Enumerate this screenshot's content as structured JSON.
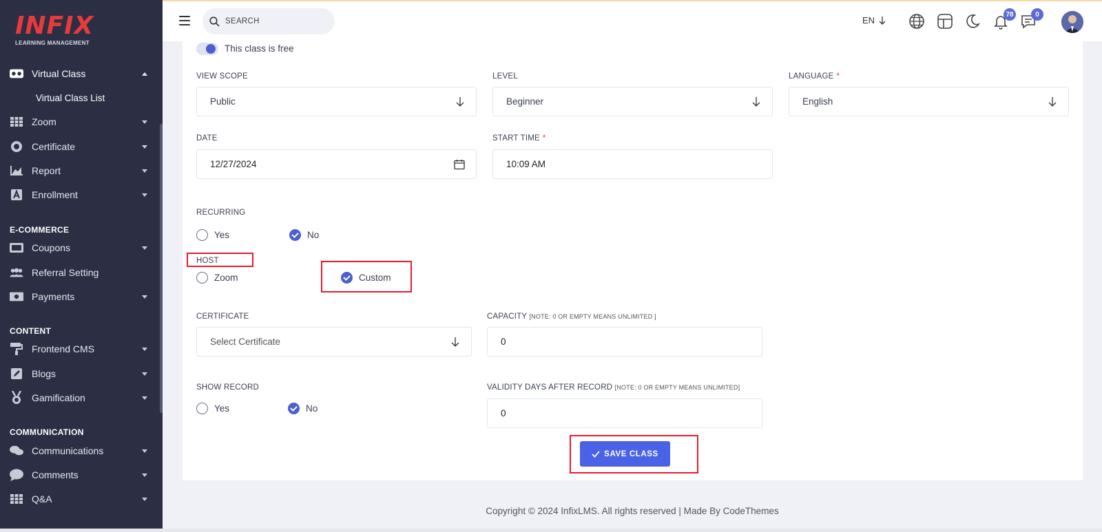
{
  "brand": {
    "logo": "INFIX",
    "tagline": "LEARNING MANAGEMENT",
    "logo_color": "#e83a3a"
  },
  "sidebar": {
    "active_item": "Virtual Class",
    "active_sub": "Virtual Class List",
    "items": [
      {
        "label": "Zoom",
        "icon": "grid-icon"
      },
      {
        "label": "Certificate",
        "icon": "certificate-icon"
      },
      {
        "label": "Report",
        "icon": "chart-icon"
      },
      {
        "label": "Enrollment",
        "icon": "enrollment-icon"
      }
    ],
    "sections": {
      "ecommerce": "E-COMMERCE",
      "content": "CONTENT",
      "communication": "COMMUNICATION"
    },
    "ecommerce_items": [
      {
        "label": "Coupons",
        "icon": "coupon-icon"
      },
      {
        "label": "Referral Setting",
        "icon": "users-icon"
      },
      {
        "label": "Payments",
        "icon": "money-icon"
      }
    ],
    "content_items": [
      {
        "label": "Frontend CMS",
        "icon": "paint-roller-icon"
      },
      {
        "label": "Blogs",
        "icon": "pencil-icon"
      },
      {
        "label": "Gamification",
        "icon": "medal-icon"
      }
    ],
    "communication_items": [
      {
        "label": "Communications",
        "icon": "chat-icon"
      },
      {
        "label": "Comments",
        "icon": "comment-icon"
      },
      {
        "label": "Q&A",
        "icon": "grid-icon"
      }
    ]
  },
  "header": {
    "search_label": "SEARCH",
    "language": "EN",
    "notifications_count": "78",
    "messages_count": "0"
  },
  "form": {
    "free_toggle_label": "This class is free",
    "view_scope": {
      "label": "VIEW SCOPE",
      "value": "Public"
    },
    "level": {
      "label": "LEVEL",
      "value": "Beginner"
    },
    "language": {
      "label": "LANGUAGE",
      "required": "*",
      "value": "English"
    },
    "date": {
      "label": "DATE",
      "value": "12/27/2024"
    },
    "start_time": {
      "label": "START TIME",
      "required": "*",
      "value": "10:09 AM"
    },
    "recurring": {
      "label": "RECURRING",
      "yes": "Yes",
      "no": "No",
      "selected": "No"
    },
    "host": {
      "label": "HOST",
      "zoom": "Zoom",
      "custom": "Custom",
      "selected": "Custom"
    },
    "certificate": {
      "label": "CERTIFICATE",
      "placeholder": "Select Certificate"
    },
    "capacity": {
      "label": "CAPACITY",
      "note": "[NOTE: 0 OR EMPTY MEANS UNLIMITED ]",
      "value": "0"
    },
    "show_record": {
      "label": "SHOW RECORD",
      "yes": "Yes",
      "no": "No",
      "selected": "No"
    },
    "validity": {
      "label": "VALIDITY DAYS AFTER RECORD",
      "note": "[NOTE: 0 OR EMPTY MEANS UNLIMITED]",
      "value": "0"
    },
    "save_label": "SAVE CLASS"
  },
  "footer": {
    "text": "Copyright © 2024 InfixLMS. All rights reserved | Made By CodeThemes"
  },
  "colors": {
    "accent": "#4a63e6",
    "sidebar_bg": "#2c2f44",
    "highlight": "#e8192c"
  }
}
